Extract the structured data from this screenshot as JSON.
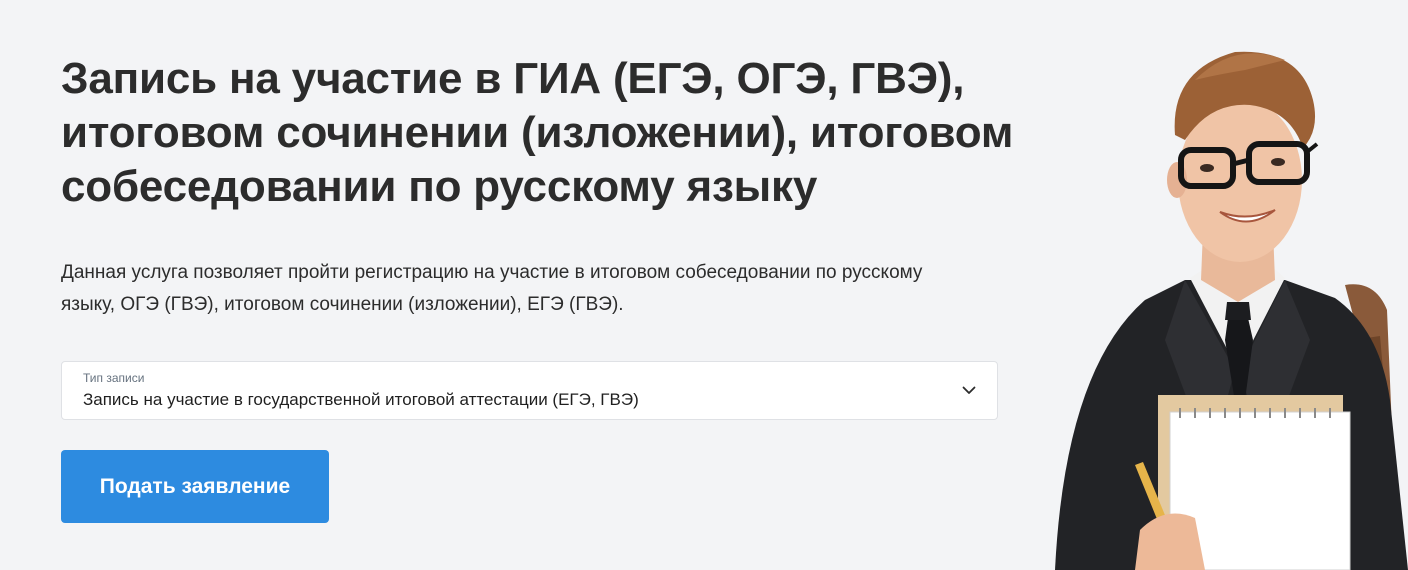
{
  "hero": {
    "title": "Запись на участие в ГИА (ЕГЭ, ОГЭ, ГВЭ), итоговом сочинении (изложении), итоговом собеседовании по русскому языку",
    "description": "Данная услуга позволяет пройти регистрацию на участие в итоговом собеседовании по русскому языку, ОГЭ (ГВЭ), итоговом сочинении (изложении), ЕГЭ (ГВЭ)."
  },
  "record_type": {
    "label": "Тип записи",
    "value": "Запись на участие в государственной итоговой аттестации (ЕГЭ, ГВЭ)"
  },
  "submit_label": "Подать заявление",
  "icons": {
    "dropdown": "chevron-down-icon"
  },
  "colors": {
    "background": "#f3f4f6",
    "accent": "#2d8be0",
    "text": "#2c2c2c"
  }
}
